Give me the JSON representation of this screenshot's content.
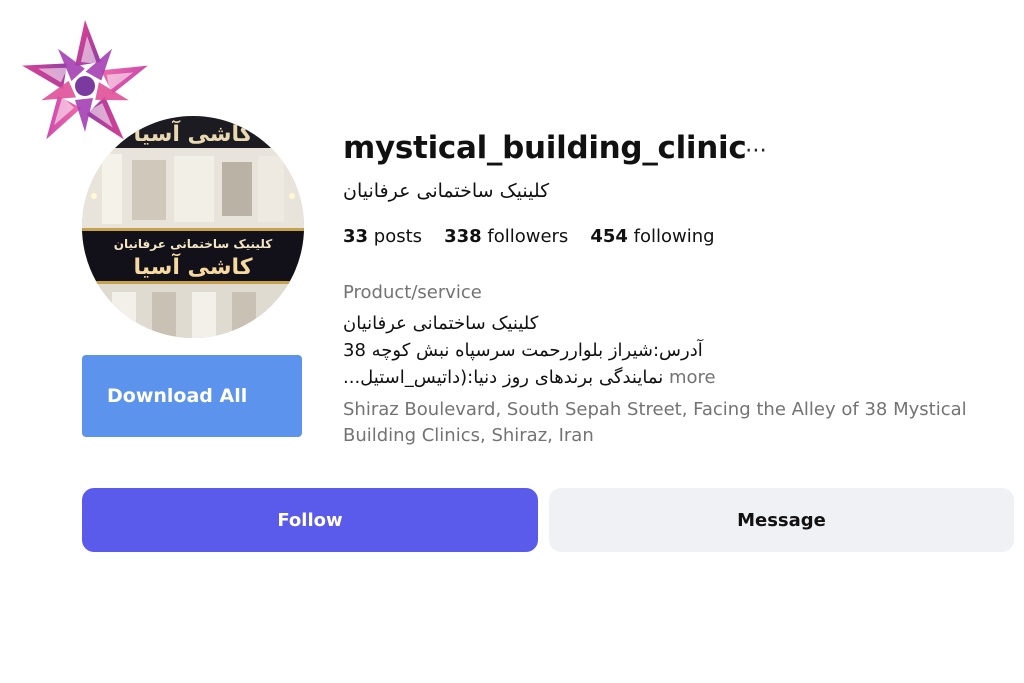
{
  "profile": {
    "username": "mystical_building_clinic",
    "more_icon": "⋯",
    "full_name": "کلینیک ساختمانی عرفانیان",
    "stats": {
      "posts_count": "33",
      "posts_label": "posts",
      "followers_count": "338",
      "followers_label": "followers",
      "following_count": "454",
      "following_label": "following"
    },
    "category": "Product/service",
    "bio": {
      "line1": "کلینیک ساختمانی عرفانیان",
      "line2": "آدرس:شیراز بلواررحمت سرسپاه نبش کوچه 38",
      "line3": "نمایندگی برندهای روز دنیا:(داتیس_استیل...",
      "more_label": "more"
    },
    "address": "Shiraz Boulevard, South Sepah Street, Facing the Alley of 38 Mystical Building Clinics, Shiraz, Iran"
  },
  "avatar": {
    "sign_top": "کاشی آسیا",
    "sign_small": "کلینیک ساختمانی عرفانیان",
    "sign_big": "کاشی آسیا"
  },
  "actions": {
    "download_label": "Download All",
    "follow_label": "Follow",
    "message_label": "Message"
  },
  "colors": {
    "follow_bg": "#5a5bea",
    "download_bg": "#5c93ed",
    "message_bg": "#eff1f4",
    "muted_text": "#737373"
  },
  "icons": {
    "logo": "pink-purple-star-logo",
    "more": "ellipsis-icon"
  }
}
